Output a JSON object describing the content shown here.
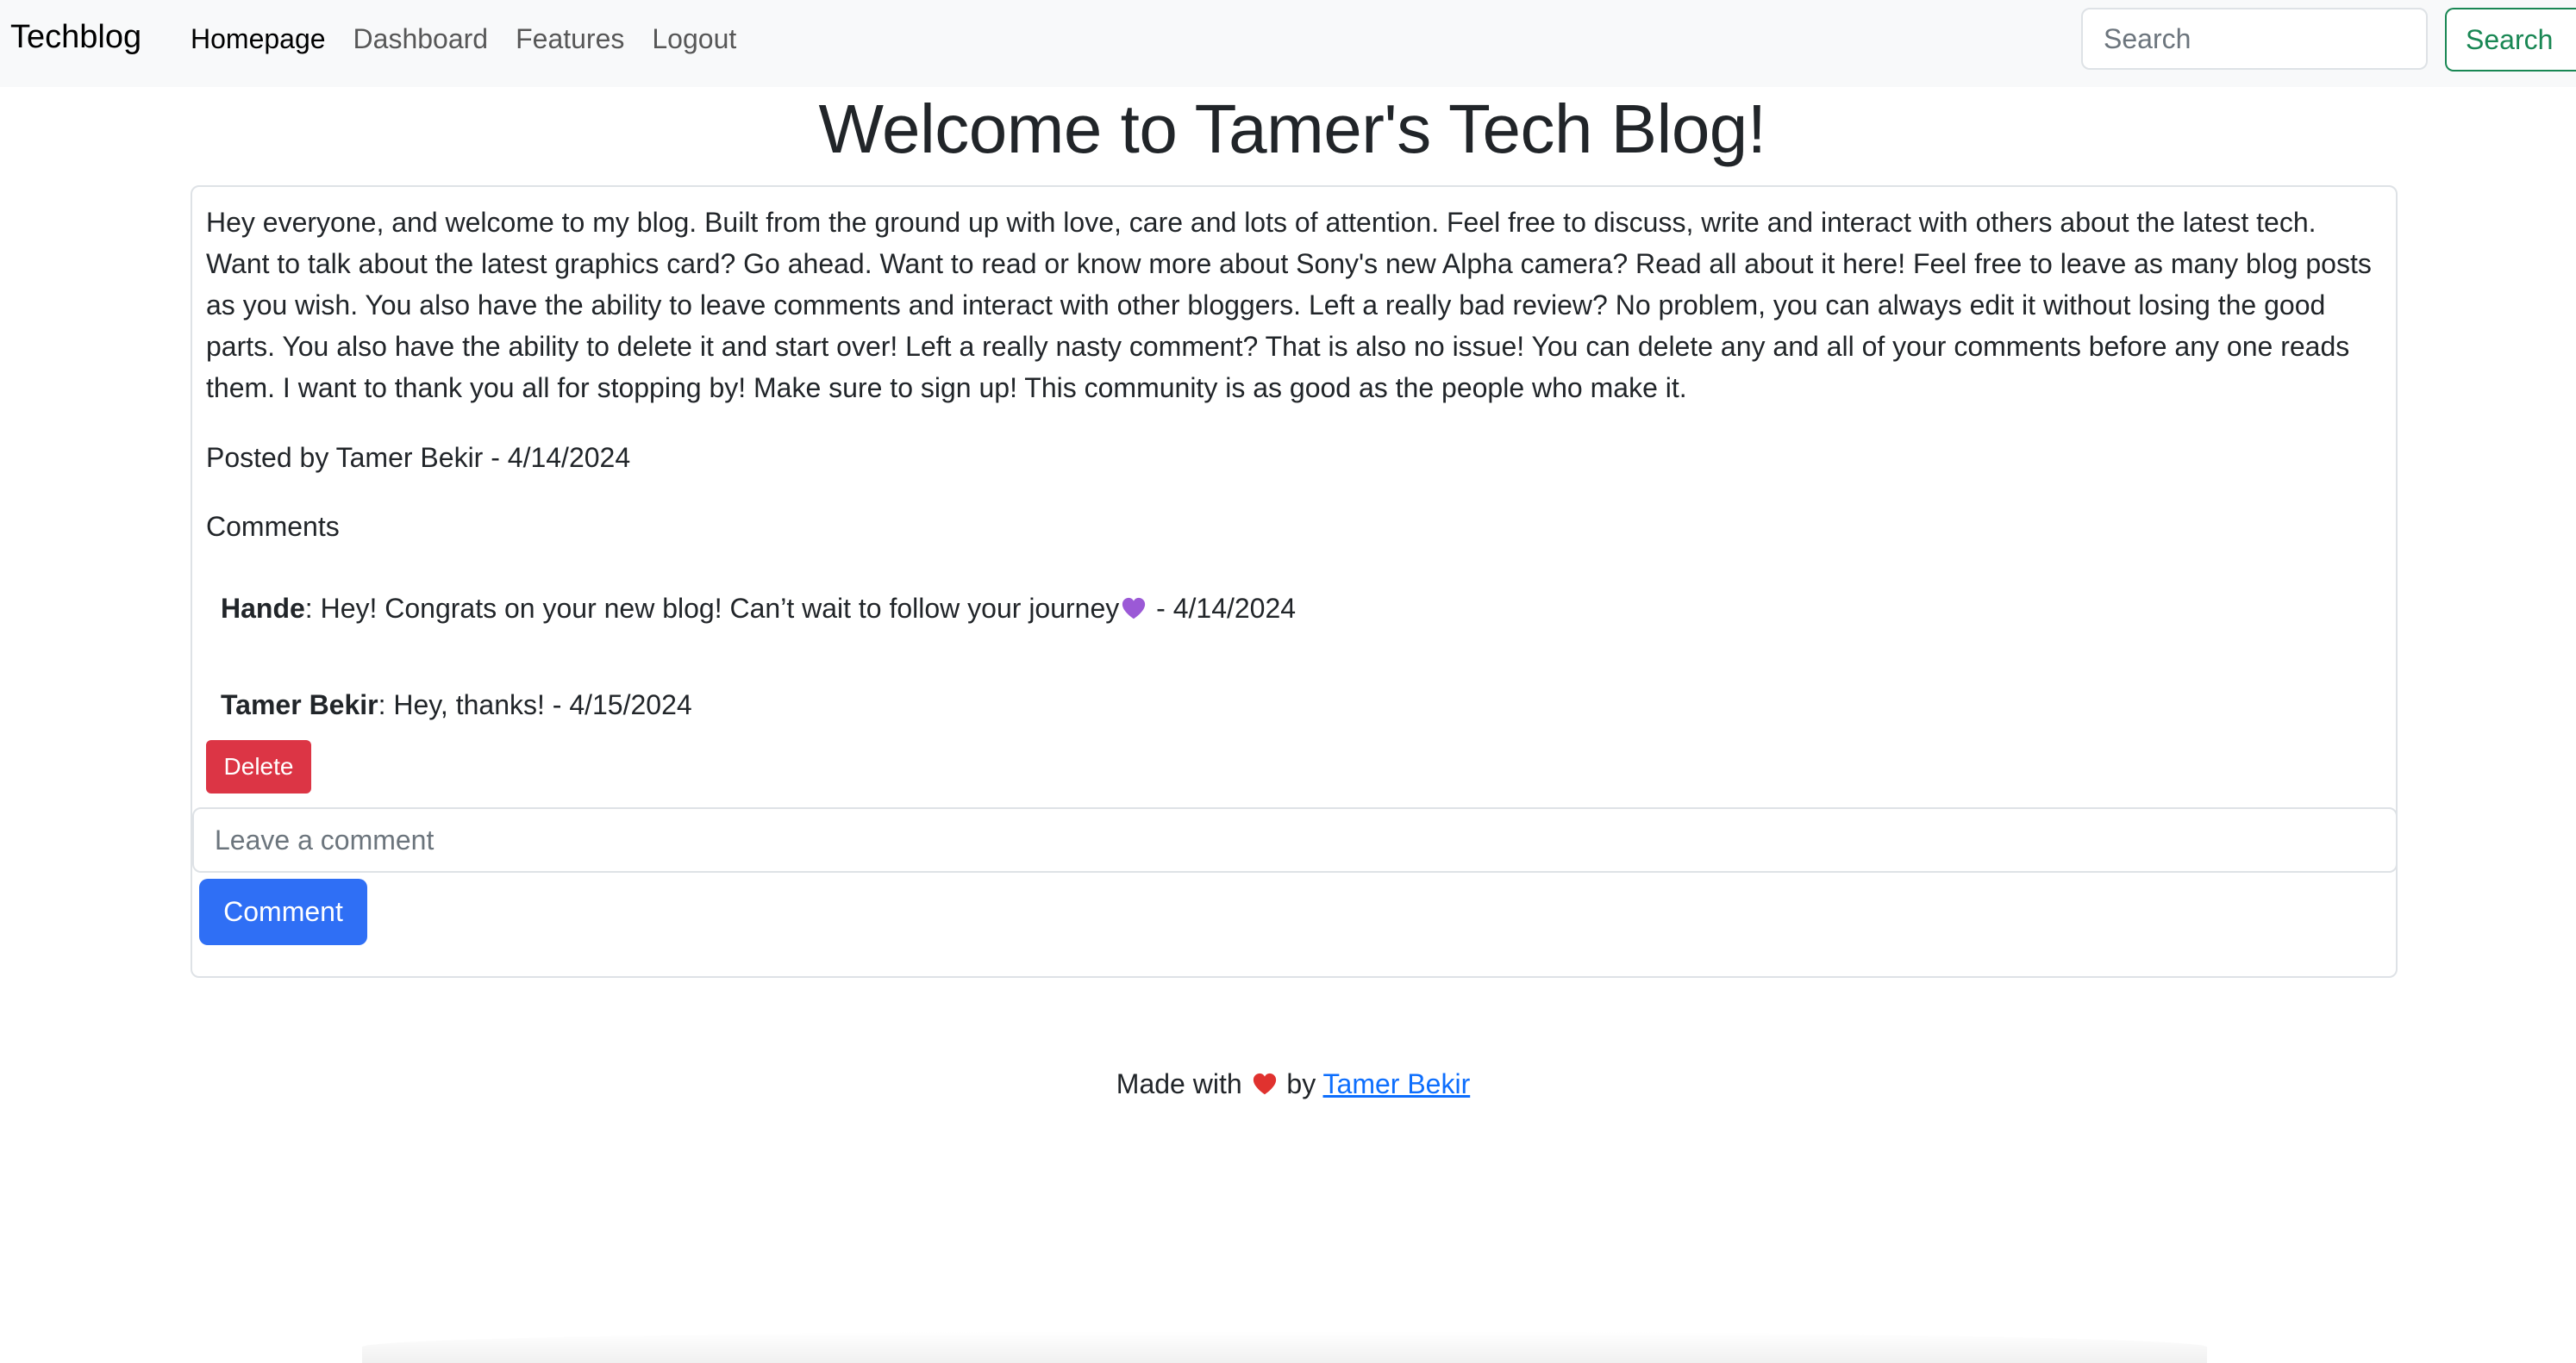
{
  "nav": {
    "brand": "Techblog",
    "links": [
      {
        "label": "Homepage",
        "active": true
      },
      {
        "label": "Dashboard",
        "active": false
      },
      {
        "label": "Features",
        "active": false
      },
      {
        "label": "Logout",
        "active": false
      }
    ],
    "search_placeholder": "Search",
    "search_button": "Search"
  },
  "page": {
    "title": "Welcome to Tamer's Tech Blog!"
  },
  "post": {
    "body": "Hey everyone, and welcome to my blog. Built from the ground up with love, care and lots of attention. Feel free to discuss, write and interact with others about the latest tech. Want to talk about the latest graphics card? Go ahead. Want to read or know more about Sony's new Alpha camera? Read all about it here! Feel free to leave as many blog posts as you wish. You also have the ability to leave comments and interact with other bloggers. Left a really bad review? No problem, you can always edit it without losing the good parts. You also have the ability to delete it and start over! Left a really nasty comment? That is also no issue! You can delete any and all of your comments before any one reads them. I want to thank you all for stopping by! Make sure to sign up! This community is as good as the people who make it.",
    "meta": "Posted by Tamer Bekir - 4/14/2024",
    "comments_heading": "Comments",
    "comments": [
      {
        "author": "Hande",
        "text": ": Hey! Congrats on your new blog! Can’t wait to follow your journey",
        "emoji": "purple-heart-icon",
        "date": " - 4/14/2024"
      },
      {
        "author": "Tamer Bekir",
        "text": ": Hey, thanks!",
        "date": " - 4/15/2024"
      }
    ],
    "delete_label": "Delete",
    "comment_placeholder": "Leave a comment",
    "comment_button": "Comment"
  },
  "footer": {
    "prefix": "Made with",
    "heart_icon": "red-heart-icon",
    "by": "by",
    "author_link": "Tamer Bekir"
  },
  "colors": {
    "delete": "#dc3545",
    "primary": "#2f6ff5",
    "success": "#198754",
    "link": "#0d6efd"
  }
}
